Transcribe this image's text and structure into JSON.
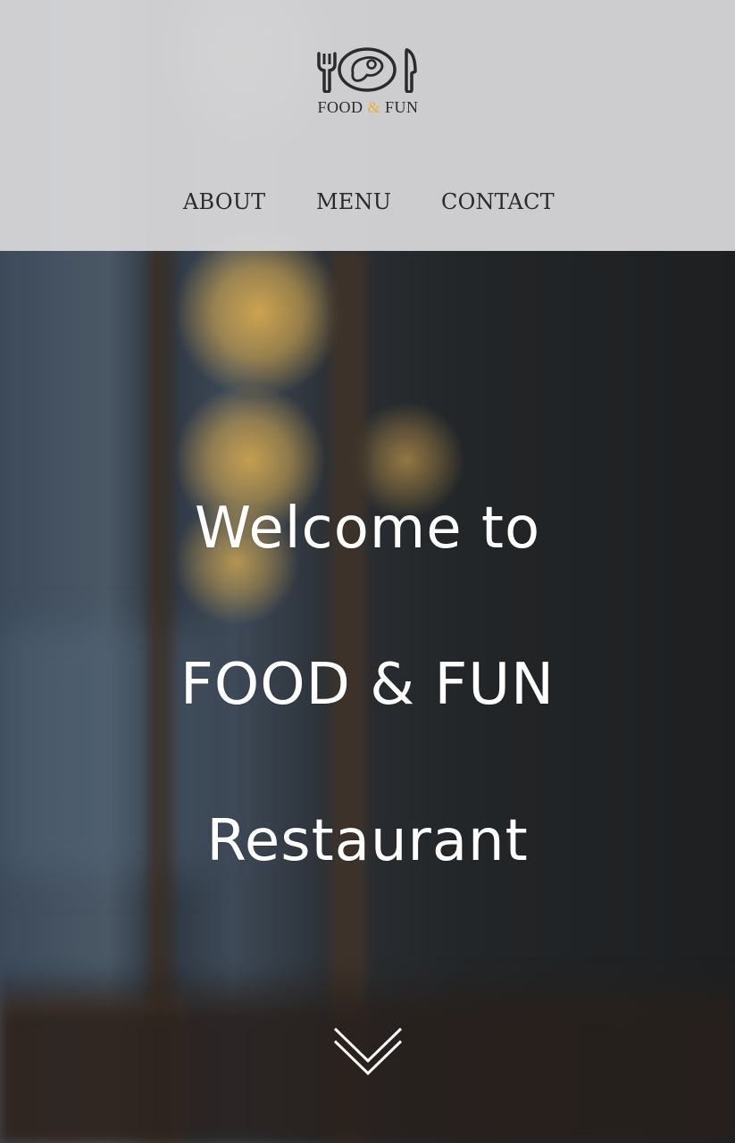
{
  "brand": {
    "logo_text_left": "FOOD ",
    "logo_text_amp": "&",
    "logo_text_right": " FUN",
    "accent_color": "#e7b23e",
    "icons": [
      "fork-icon",
      "plate-icon",
      "knife-icon"
    ]
  },
  "nav": {
    "items": [
      {
        "label": "ABOUT"
      },
      {
        "label": "MENU"
      },
      {
        "label": "CONTACT"
      }
    ]
  },
  "hero": {
    "line1": "Welcome to",
    "line2": "FOOD & FUN",
    "line3": "Restaurant",
    "scroll_icon": "chevron-double-down-icon"
  }
}
